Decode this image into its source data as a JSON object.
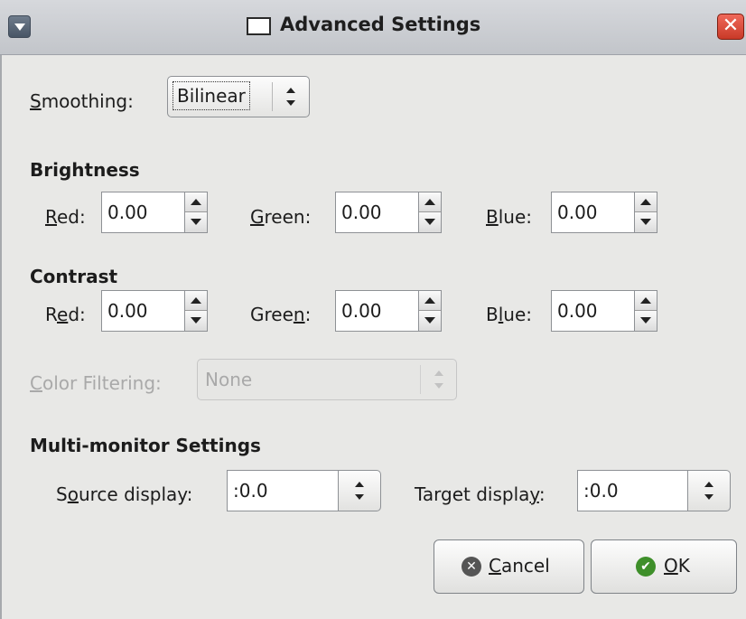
{
  "window": {
    "title": "Advanced Settings"
  },
  "titlebar": {
    "menu_icon": "menu-down-arrow-icon",
    "window_icon": "window-icon",
    "close_icon": "close-x-icon",
    "close_glyph": "✕"
  },
  "smoothing": {
    "label": "Smoothing:",
    "mnemonic": "S",
    "rest": "moothing:",
    "value": "Bilinear"
  },
  "brightness": {
    "heading": "Brightness",
    "red": {
      "mnemonic": "R",
      "rest": "ed:",
      "value": "0.00"
    },
    "green": {
      "mnemonic": "G",
      "rest": "reen:",
      "value": "0.00"
    },
    "blue": {
      "mnemonic": "B",
      "rest": "lue:",
      "value": "0.00"
    }
  },
  "contrast": {
    "heading": "Contrast",
    "red": {
      "pre": "R",
      "mnemonic": "e",
      "rest": "d:",
      "value": "0.00"
    },
    "green": {
      "pre": "Gree",
      "mnemonic": "n",
      "rest": ":",
      "value": "0.00"
    },
    "blue": {
      "pre": "B",
      "mnemonic": "l",
      "rest": "ue:",
      "value": "0.00"
    }
  },
  "color_filtering": {
    "mnemonic": "C",
    "rest": "olor Filtering:",
    "value": "None",
    "enabled": false
  },
  "multi_monitor": {
    "heading": "Multi-monitor Settings",
    "source": {
      "pre": "S",
      "mnemonic": "o",
      "rest": "urce display:",
      "value": ":0.0"
    },
    "target": {
      "pre": "Target displa",
      "mnemonic": "y",
      "rest": ":",
      "value": ":0.0"
    }
  },
  "buttons": {
    "cancel": {
      "mnemonic": "C",
      "rest": "ancel",
      "icon": "cancel-circle-icon",
      "glyph": "✕"
    },
    "ok": {
      "mnemonic": "O",
      "rest": "K",
      "icon": "check-circle-icon",
      "glyph": "✔"
    }
  }
}
